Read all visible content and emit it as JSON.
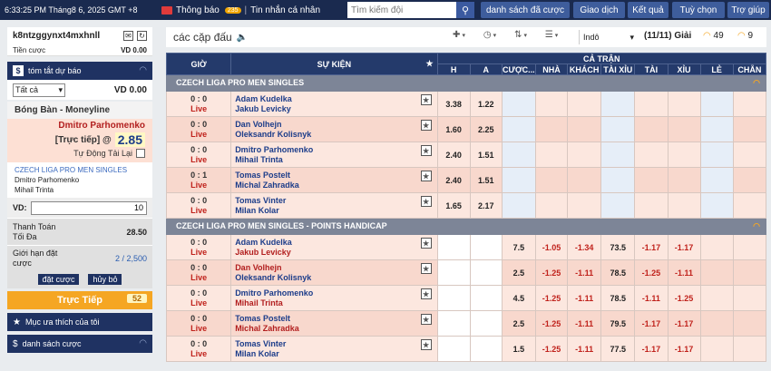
{
  "topbar": {
    "datetime": "6:33:25 PM Tháng8 6, 2025 GMT +8",
    "notice_label": "Thông báo",
    "notice_count": "235",
    "messages_label": "Tin nhắn cá nhân",
    "search_placeholder": "Tìm kiếm đội",
    "nav": [
      "danh sách đã cược",
      "Giao dịch",
      "Kết quả",
      "Tuỳ chọn",
      "Trợ giúp"
    ]
  },
  "sidebar": {
    "username": "k8ntzggynxt4mxhnll",
    "balance_label": "Tiền cược",
    "balance_value": "VD 0.00",
    "summary_header": "tóm tắt dự báo",
    "filter_value": "Tất cả",
    "filter_amount": "VD 0.00",
    "slip_title": "Bóng Bàn - Moneyline",
    "slip_team": "Dmitro Parhomenko",
    "slip_live": "[Trực tiếp] @",
    "slip_odds": "2.85",
    "slip_auto": "Tự Động Tải Lại",
    "slip_league": "CZECH LIGA PRO MEN SINGLES",
    "slip_home": "Dmitro Parhomenko",
    "slip_away": "Mihail Trinta",
    "vd_label": "VD:",
    "vd_value": "10",
    "max_payout_label": "Thanh Toán Tối Đa",
    "max_payout_value": "28.50",
    "limit_label": "Giới hạn đặt cược",
    "limit_value": "2 / 2,500",
    "place_bet": "đặt cược",
    "cancel": "hủy bỏ",
    "live_label": "Trực Tiếp",
    "live_count": "52",
    "fav_label": "Mục ưa thích của tôi",
    "bets_label": "danh sách cược"
  },
  "main": {
    "title": "các cặp đấu",
    "odds_format": "Indô",
    "count": "(11/11) Giải",
    "count_c": "49",
    "count_g": "9",
    "headers": {
      "time": "GIỜ",
      "event": "SỰ KIỆN",
      "full": "CẢ TRẬN",
      "cols": [
        "H",
        "A",
        "CƯỢC...",
        "NHÀ",
        "KHÁCH",
        "TÀI XỈU",
        "TÀI",
        "XỈU",
        "LẺ",
        "CHẴN"
      ]
    },
    "leagues": [
      {
        "name": "CZECH LIGA PRO MEN SINGLES",
        "matches": [
          {
            "score": "0 : 0",
            "status": "Live",
            "home": "Adam Kudelka",
            "away": "Jakub Levicky",
            "h": "3.38",
            "a": "1.22"
          },
          {
            "score": "0 : 0",
            "status": "Live",
            "home": "Dan Volhejn",
            "away": "Oleksandr Kolisnyk",
            "h": "1.60",
            "a": "2.25"
          },
          {
            "score": "0 : 0",
            "status": "Live",
            "home": "Dmitro Parhomenko",
            "away": "Mihail Trinta",
            "h": "2.40",
            "a": "1.51"
          },
          {
            "score": "0 : 1",
            "status": "Live",
            "home": "Tomas Postelt",
            "away": "Michal Zahradka",
            "h": "2.40",
            "a": "1.51"
          },
          {
            "score": "0 : 0",
            "status": "Live",
            "home": "Tomas Vinter",
            "away": "Milan Kolar",
            "h": "1.65",
            "a": "2.17"
          }
        ]
      },
      {
        "name": "CZECH LIGA PRO MEN SINGLES - POINTS HANDICAP",
        "matches": [
          {
            "score": "0 : 0",
            "status": "Live",
            "home": "Adam Kudelka",
            "away": "Jakub Levicky",
            "hdp": "7.5",
            "home_o": "-1.05",
            "away_o": "-1.34",
            "ou": "73.5",
            "over": "-1.17",
            "under": "-1.17"
          },
          {
            "score": "0 : 0",
            "status": "Live",
            "home": "Dan Volhejn",
            "away": "Oleksandr Kolisnyk",
            "hdp": "2.5",
            "home_o": "-1.25",
            "away_o": "-1.11",
            "ou": "78.5",
            "over": "-1.25",
            "under": "-1.11"
          },
          {
            "score": "0 : 0",
            "status": "Live",
            "home": "Dmitro Parhomenko",
            "away": "Mihail Trinta",
            "hdp": "4.5",
            "home_o": "-1.25",
            "away_o": "-1.11",
            "ou": "78.5",
            "over": "-1.11",
            "under": "-1.25"
          },
          {
            "score": "0 : 0",
            "status": "Live",
            "home": "Tomas Postelt",
            "away": "Michal Zahradka",
            "hdp": "2.5",
            "home_o": "-1.25",
            "away_o": "-1.11",
            "ou": "79.5",
            "over": "-1.17",
            "under": "-1.17"
          },
          {
            "score": "0 : 0",
            "status": "Live",
            "home": "Tomas Vinter",
            "away": "Milan Kolar",
            "hdp": "1.5",
            "home_o": "-1.25",
            "away_o": "-1.11",
            "ou": "77.5",
            "over": "-1.17",
            "under": "-1.17"
          }
        ]
      }
    ]
  },
  "colors": {
    "navy": "#1f3262",
    "header": "#243a6b",
    "live_red": "#c0221c",
    "accent_orange": "#f5a623",
    "row_pink": "#fce7df"
  }
}
